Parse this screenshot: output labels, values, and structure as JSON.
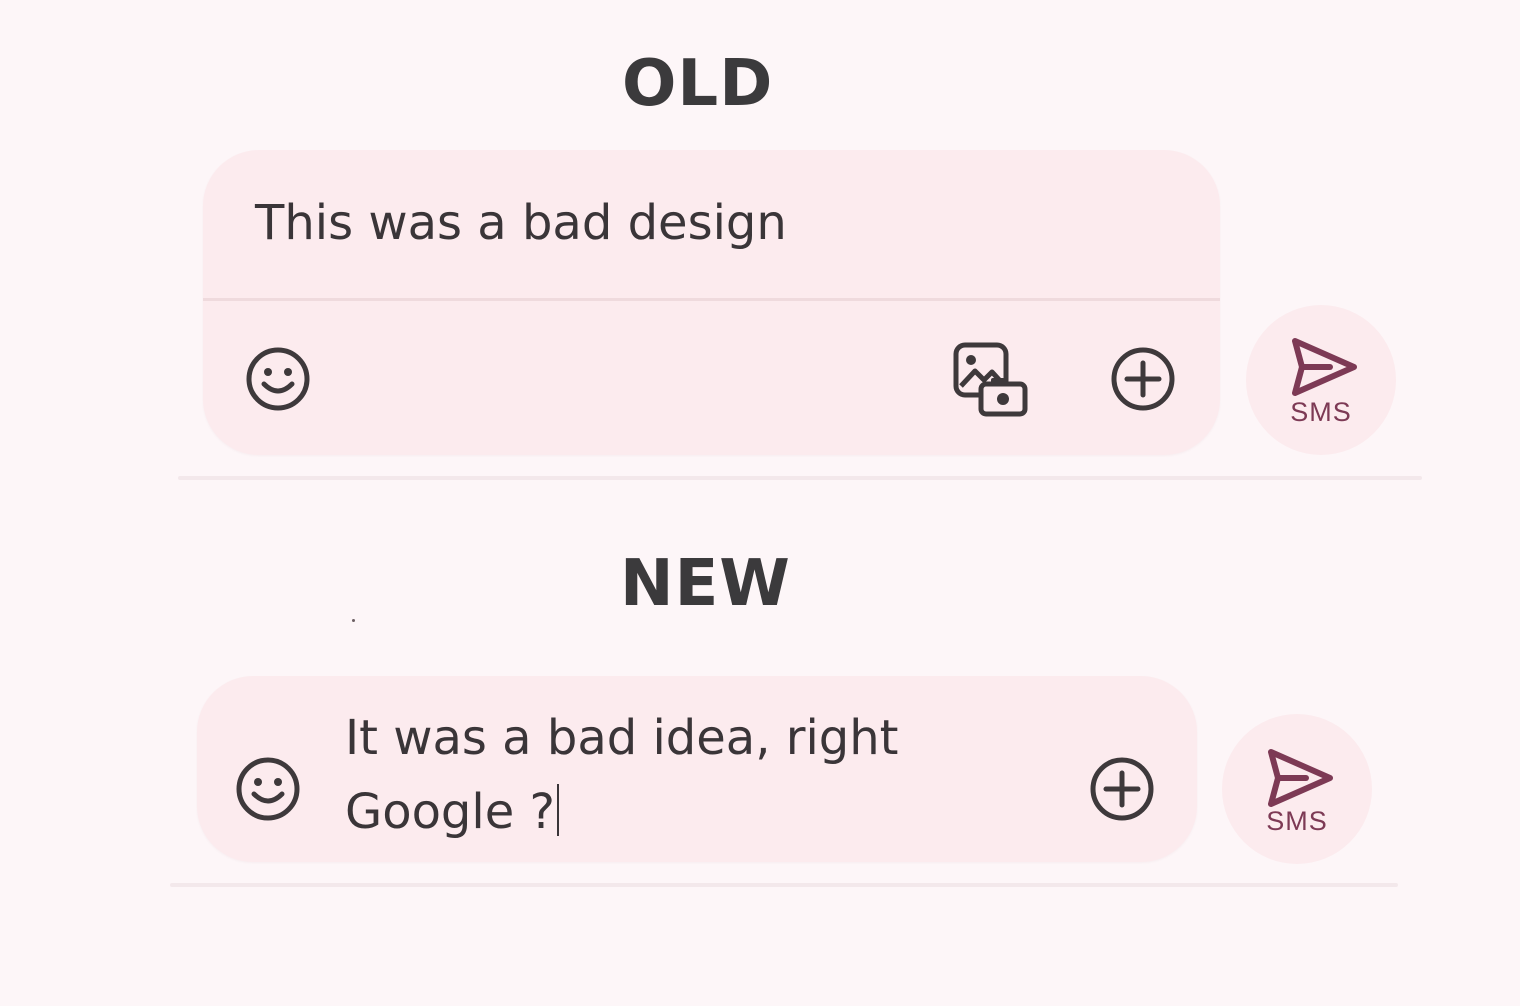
{
  "old": {
    "heading": "OLD",
    "message_text": "This was a bad design",
    "send_label": "SMS"
  },
  "new": {
    "heading": "NEW",
    "message_line1": "It was a bad idea, right",
    "message_line2": "Google ?",
    "send_label": "SMS"
  },
  "icons": {
    "emoji": "smiley-face-icon",
    "media": "gallery-camera-icon",
    "attach": "plus-circle-icon",
    "send": "send-arrow-icon"
  },
  "colors": {
    "background": "#fdf6f8",
    "compose_fill": "#fcebee",
    "icon": "#3e393b",
    "send_accent": "#7d3a55"
  }
}
